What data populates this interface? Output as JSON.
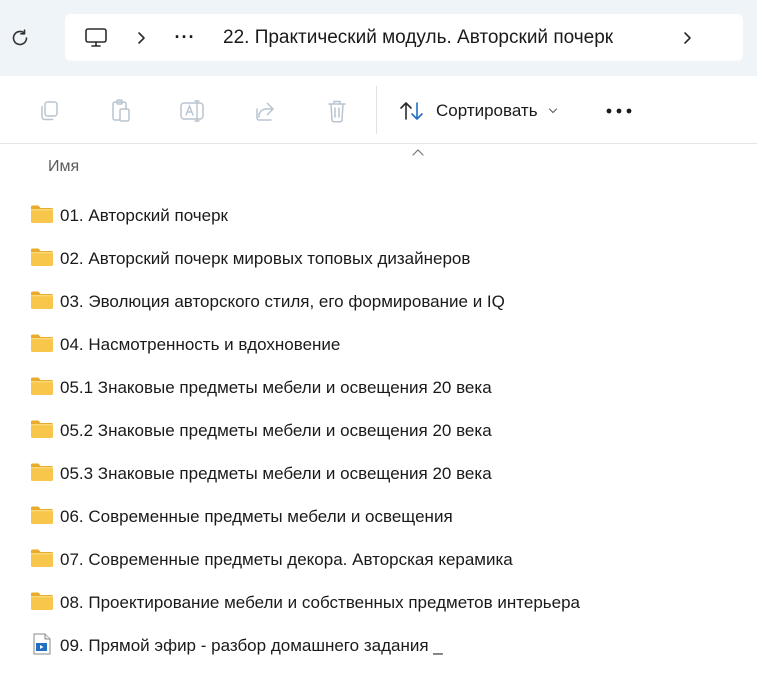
{
  "address_bar": {
    "refresh_icon": "refresh-icon",
    "pc_icon": "this-pc-icon",
    "overflow": "···",
    "current_folder": "22. Практический модуль. Авторский почерк"
  },
  "toolbar": {
    "copy_icon": "copy-icon",
    "paste_icon": "paste-icon",
    "rename_icon": "rename-icon",
    "share_icon": "share-icon",
    "delete_icon": "delete-icon",
    "sort_label": "Сортировать",
    "more_icon": "more-icon"
  },
  "columns": {
    "name": "Имя"
  },
  "files": [
    {
      "name": "01. Авторский почерк",
      "type": "folder"
    },
    {
      "name": "02. Авторский почерк мировых топовых дизайнеров",
      "type": "folder"
    },
    {
      "name": "03. Эволюция авторского стиля, его формирование и IQ",
      "type": "folder"
    },
    {
      "name": "04. Насмотренность и вдохновение",
      "type": "folder"
    },
    {
      "name": "05.1 Знаковые предметы мебели и освещения 20 века",
      "type": "folder"
    },
    {
      "name": "05.2 Знаковые предметы мебели и освещения 20 века",
      "type": "folder"
    },
    {
      "name": "05.3 Знаковые предметы мебели и освещения 20 века",
      "type": "folder"
    },
    {
      "name": "06. Современные предметы мебели и освещения",
      "type": "folder"
    },
    {
      "name": "07. Современные предметы декора. Авторская керамика",
      "type": "folder"
    },
    {
      "name": "08. Проектирование мебели и собственных предметов интерьера",
      "type": "folder"
    },
    {
      "name": "09. Прямой эфир - разбор домашнего задания _",
      "type": "video"
    }
  ],
  "colors": {
    "address_bg": "#eff4f9",
    "folder_yellow": "#f8c64a",
    "accent_blue": "#1f6fc5"
  }
}
